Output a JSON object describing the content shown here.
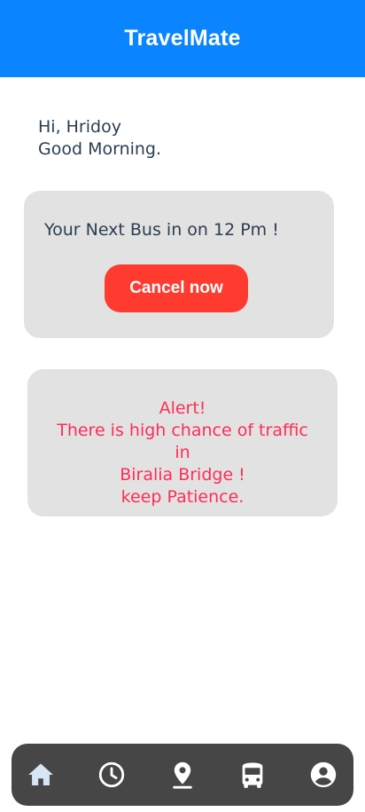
{
  "app": {
    "title": "TravelMate"
  },
  "greeting": {
    "line1": "Hi, Hridoy",
    "line2": "Good Morning."
  },
  "bus_card": {
    "message": "Your Next Bus in on 12 Pm !",
    "cancel_label": "Cancel now"
  },
  "alert_card": {
    "lines": [
      "Alert!",
      "There is high chance of traffic",
      "in",
      "Biralia Bridge !",
      "keep Patience."
    ]
  },
  "tabbar": {
    "items": [
      {
        "icon": "home-icon",
        "active": true
      },
      {
        "icon": "clock-icon",
        "active": false
      },
      {
        "icon": "location-pin-icon",
        "active": false
      },
      {
        "icon": "bus-icon",
        "active": false
      },
      {
        "icon": "account-icon",
        "active": false
      }
    ]
  },
  "colors": {
    "header": "#0a84ff",
    "cancel_button": "#ff3b30",
    "alert_text": "#ff2d55",
    "card_background": "#e2e2e2",
    "tabbar": "#464646",
    "active_tab_icon": "#d6e6f5"
  }
}
